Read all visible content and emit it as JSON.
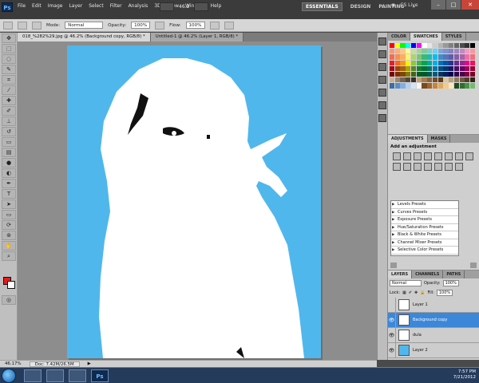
{
  "app": {
    "logo": "Ps",
    "menu": [
      "File",
      "Edit",
      "Image",
      "Layer",
      "Select",
      "Filter",
      "Analysis",
      "3D",
      "View",
      "Window",
      "Help"
    ],
    "zoom_value": "46.2",
    "workspaces": [
      "ESSENTIALS",
      "DESIGN",
      "PAINTING"
    ],
    "cs_live": "CS Live"
  },
  "options_bar": {
    "mode_label": "Mode:",
    "mode_value": "Normal",
    "opacity_label": "Opacity:",
    "opacity_value": "100%",
    "flow_label": "Flow:",
    "flow_value": "100%"
  },
  "tabs": [
    {
      "label": "018_%282%29.jpg @ 46.2% (Background copy, RGB/8) *"
    },
    {
      "label": "Untitled-1 @ 46.2% (Layer 1, RGB/8) *"
    }
  ],
  "status": {
    "zoom": "46.17%",
    "doc": "Doc: 7.42M/26.5M"
  },
  "panels": {
    "swatches_tabs": [
      "COLOR",
      "SWATCHES",
      "STYLES"
    ],
    "adjust_tabs": [
      "ADJUSTMENTS",
      "MASKS"
    ],
    "adjust_header": "Add an adjustment",
    "presets": [
      "Levels Presets",
      "Curves Presets",
      "Exposure Presets",
      "Hue/Saturation Presets",
      "Black & White Presets",
      "Channel Mixer Presets",
      "Selective Color Presets"
    ],
    "layers_tabs": [
      "LAYERS",
      "CHANNELS",
      "PATHS"
    ],
    "layers_mode": "Normal",
    "opacity_label": "Opacity:",
    "opacity_value": "100%",
    "lock_label": "Lock:",
    "fill_label": "Fill:",
    "fill_value": "100%",
    "layers": [
      {
        "name": "Layer 1",
        "visible": false,
        "thumb": "#ffffff",
        "selected": false
      },
      {
        "name": "Background copy",
        "visible": true,
        "thumb": "#ffffff",
        "selected": true
      },
      {
        "name": "dula",
        "visible": true,
        "thumb": "#ffffff",
        "selected": false
      },
      {
        "name": "Layer 2",
        "visible": true,
        "thumb": "#50b7ec",
        "selected": false
      }
    ]
  },
  "taskbar": {
    "time": "7:57 PM",
    "date": "7/21/2012"
  },
  "colors": {
    "canvas_bg": "#50b7ec",
    "foreground": "#e21c1c",
    "background": "#ffffff"
  }
}
